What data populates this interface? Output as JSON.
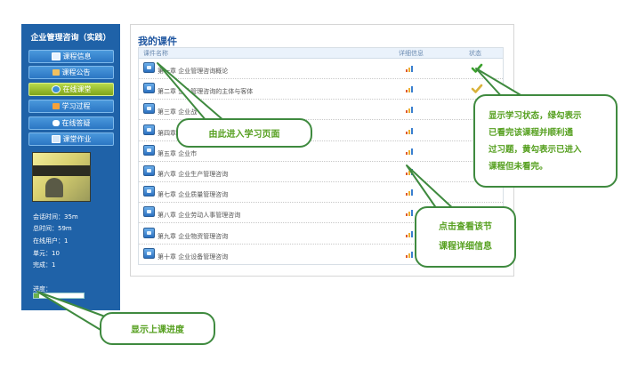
{
  "sidebar": {
    "course_title": "企业管理咨询（实践）",
    "nav": [
      {
        "label": "课程信息",
        "icon": "book-icon",
        "active": false
      },
      {
        "label": "课程公告",
        "icon": "megaphone-icon",
        "active": false
      },
      {
        "label": "在线课堂",
        "icon": "globe-icon",
        "active": true
      },
      {
        "label": "学习过程",
        "icon": "document-icon",
        "active": false
      },
      {
        "label": "在线答疑",
        "icon": "chat-icon",
        "active": false
      },
      {
        "label": "课堂作业",
        "icon": "homework-icon",
        "active": false
      }
    ],
    "stats": {
      "session_time": "会话时间：35m",
      "total_time": "总时间：59m",
      "online_users": "在线用户：1",
      "units": "单元：10",
      "completed": "完成：1"
    },
    "progress_label": "进度：",
    "progress_fraction": 0.1
  },
  "main": {
    "title": "我的课件",
    "columns": {
      "name": "课件名称",
      "detail": "详细信息",
      "status": "状态"
    },
    "rows": [
      {
        "name": "第一章 企业管理咨询概论",
        "status": "green-check"
      },
      {
        "name": "第二章 企业管理咨询的主体与客体",
        "status": "yellow-check"
      },
      {
        "name": "第三章 企业战",
        "status": "none"
      },
      {
        "name": "第四章 企",
        "status": "none"
      },
      {
        "name": "第五章 企业市",
        "status": "none"
      },
      {
        "name": "第六章 企业生产管理咨询",
        "status": "none"
      },
      {
        "name": "第七章 企业质量管理咨询",
        "status": "none"
      },
      {
        "name": "第八章 企业劳动人事管理咨询",
        "status": "none"
      },
      {
        "name": "第九章 企业物资管理咨询",
        "status": "none"
      },
      {
        "name": "第十章 企业设备管理咨询",
        "status": "none"
      }
    ]
  },
  "callouts": {
    "enter": "由此进入学习页面",
    "status_line1": "显示学习状态，绿勾表示",
    "status_line2": "已看完该课程并顺利通",
    "status_line3": "过习题，黄勾表示已进入",
    "status_line4": "课程但未看完。",
    "detail_line1": "点击查看该节",
    "detail_line2": "课程详细信息",
    "progress": "显示上课进度"
  },
  "colors": {
    "sidebar_bg": "#1f62a8",
    "active_nav": "#9cc22e",
    "title_blue": "#1f56a0",
    "callout_border": "#3f8a3f",
    "callout_text": "#56a020",
    "check_green": "#3aa02c",
    "check_yellow": "#d9b23a"
  }
}
